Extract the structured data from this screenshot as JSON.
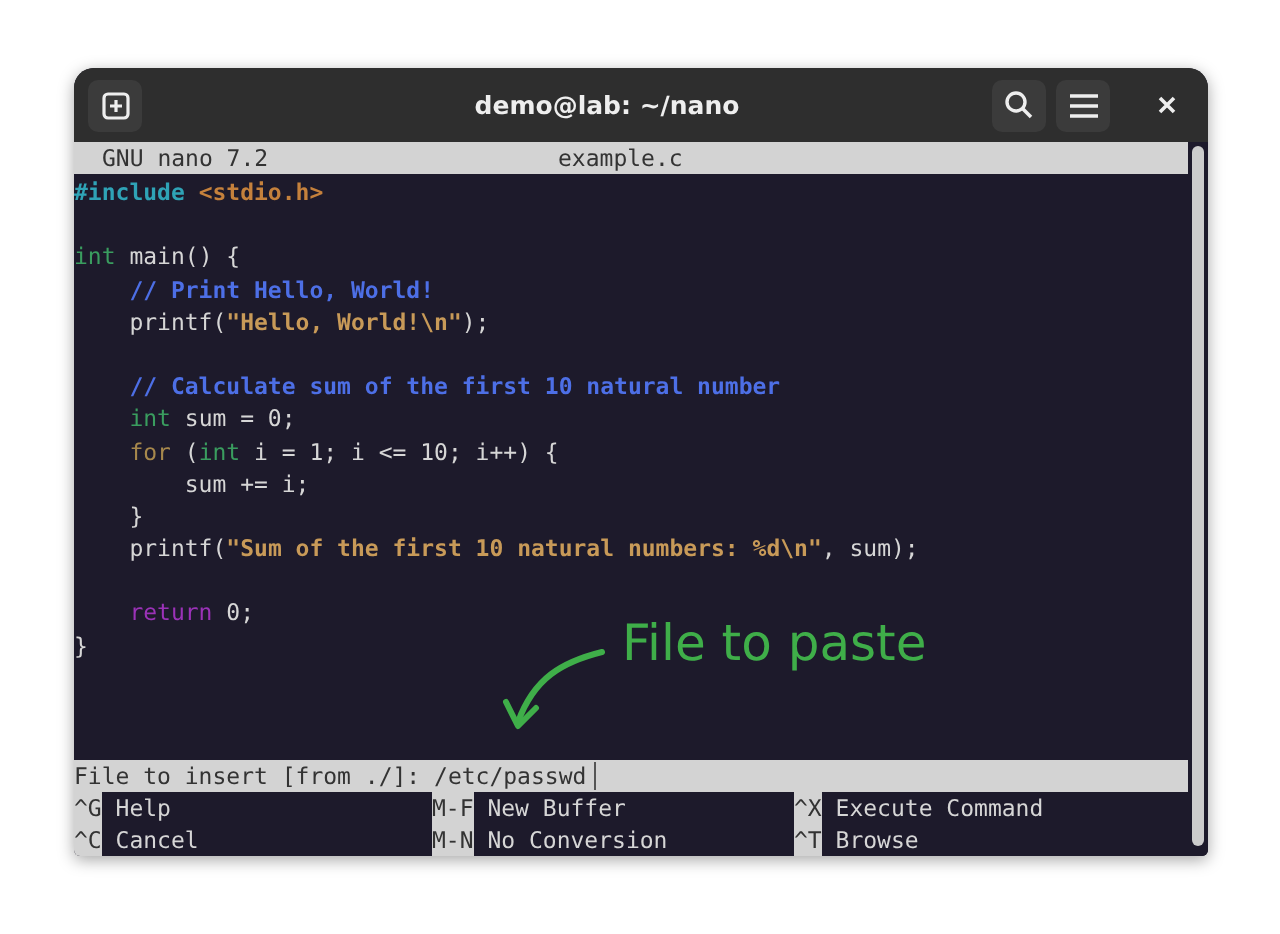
{
  "window": {
    "title": "demo@lab: ~/nano"
  },
  "nano_header": {
    "version": "GNU nano 7.2",
    "filename": "example.c"
  },
  "code_lines": [
    {
      "kind": "code",
      "segments": [
        {
          "kind": "preproc",
          "text": "#include"
        },
        {
          "kind": "header",
          "text": "<stdio.h>"
        }
      ]
    },
    {
      "kind": "blank"
    },
    {
      "kind": "code",
      "segments": [
        {
          "kind": "type",
          "text": "int"
        },
        {
          "kind": "plain",
          "text": " main() {"
        }
      ]
    },
    {
      "kind": "code",
      "segments": [
        {
          "kind": "comment",
          "text": "    // Print Hello, World!"
        }
      ]
    },
    {
      "kind": "code",
      "segments": [
        {
          "kind": "plain",
          "text": "    printf("
        },
        {
          "kind": "string",
          "text": "\"Hello, World!\\n\""
        },
        {
          "kind": "plain",
          "text": ");"
        }
      ]
    },
    {
      "kind": "blank"
    },
    {
      "kind": "code",
      "segments": [
        {
          "kind": "comment",
          "text": "    // Calculate sum of the first 10 natural number"
        }
      ]
    },
    {
      "kind": "code",
      "segments": [
        {
          "kind": "type",
          "text": "    int"
        },
        {
          "kind": "plain",
          "text": " sum = 0;"
        }
      ]
    },
    {
      "kind": "code",
      "segments": [
        {
          "kind": "keyword",
          "text": "    for"
        },
        {
          "kind": "plain",
          "text": " ("
        },
        {
          "kind": "type",
          "text": "int"
        },
        {
          "kind": "plain",
          "text": " i = 1; i <= 10; i++) {"
        }
      ]
    },
    {
      "kind": "code",
      "segments": [
        {
          "kind": "plain",
          "text": "        sum += i;"
        }
      ]
    },
    {
      "kind": "code",
      "segments": [
        {
          "kind": "plain",
          "text": "    }"
        }
      ]
    },
    {
      "kind": "code",
      "segments": [
        {
          "kind": "plain",
          "text": "    printf("
        },
        {
          "kind": "string",
          "text": "\"Sum of the first 10 natural numbers: %d\\n\""
        },
        {
          "kind": "plain",
          "text": ", sum);"
        }
      ]
    },
    {
      "kind": "blank"
    },
    {
      "kind": "code",
      "segments": [
        {
          "kind": "return",
          "text": "    return"
        },
        {
          "kind": "plain",
          "text": " 0;"
        }
      ]
    },
    {
      "kind": "code",
      "segments": [
        {
          "kind": "plain",
          "text": "}"
        }
      ]
    }
  ],
  "annotation": {
    "text": "File to paste"
  },
  "prompt": {
    "label": "File to insert [from ./]:",
    "value": "/etc/passwd"
  },
  "shortcuts": [
    {
      "key": "^G",
      "label": "Help"
    },
    {
      "key": "M-F",
      "label": "New Buffer"
    },
    {
      "key": "^X",
      "label": "Execute Command"
    },
    {
      "key": "^C",
      "label": "Cancel"
    },
    {
      "key": "M-N",
      "label": "No Conversion"
    },
    {
      "key": "^T",
      "label": "Browse"
    }
  ]
}
